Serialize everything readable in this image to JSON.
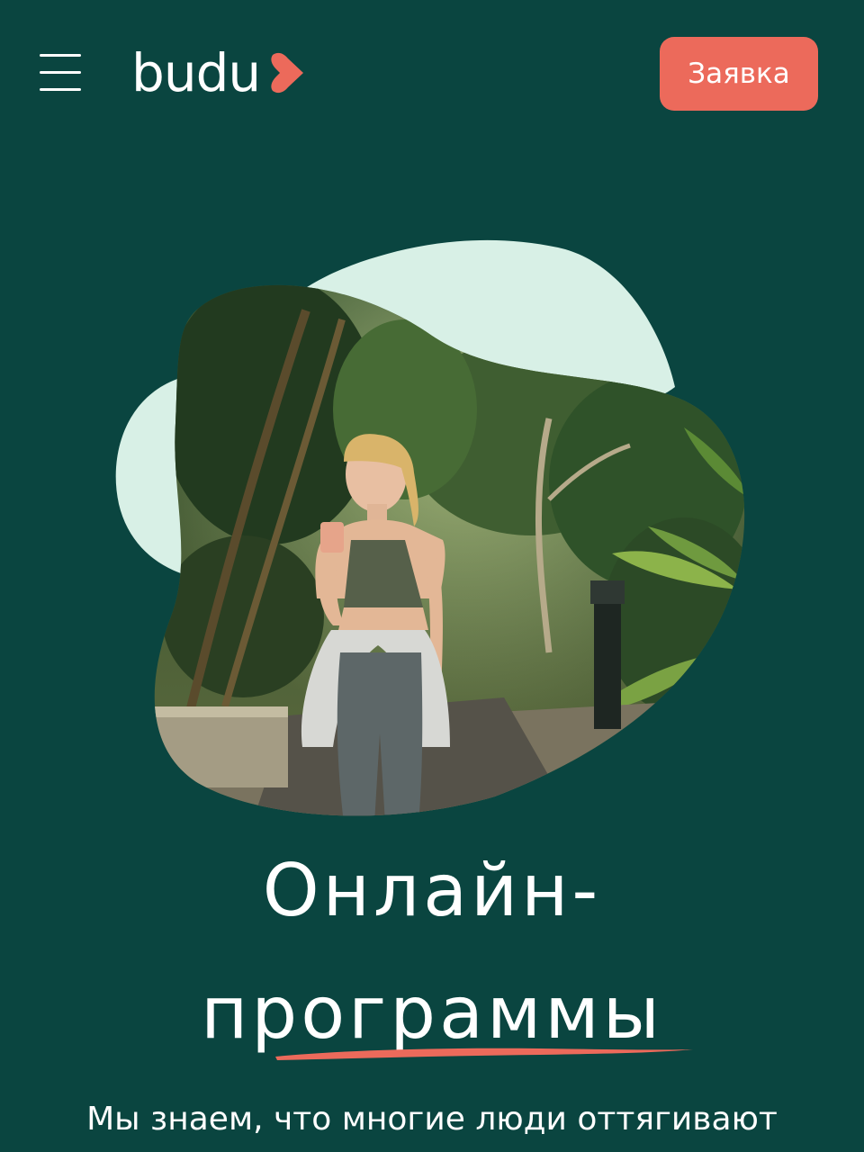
{
  "header": {
    "logo_text": "budu",
    "request_button_label": "Заявка"
  },
  "hero": {
    "image_description": "Woman in sportswear walking in a tropical garden while looking at her phone"
  },
  "headline": {
    "line1": "Онлайн-",
    "line2": "программы"
  },
  "description": "Мы знаем, что многие люди оттягивают",
  "colors": {
    "background": "#0a4540",
    "accent": "#ec6a5b",
    "blob_light": "#d8f0e6",
    "text": "#ffffff"
  },
  "icons": {
    "menu": "hamburger-menu-icon",
    "logo_mark": "heart-arrow-icon"
  }
}
